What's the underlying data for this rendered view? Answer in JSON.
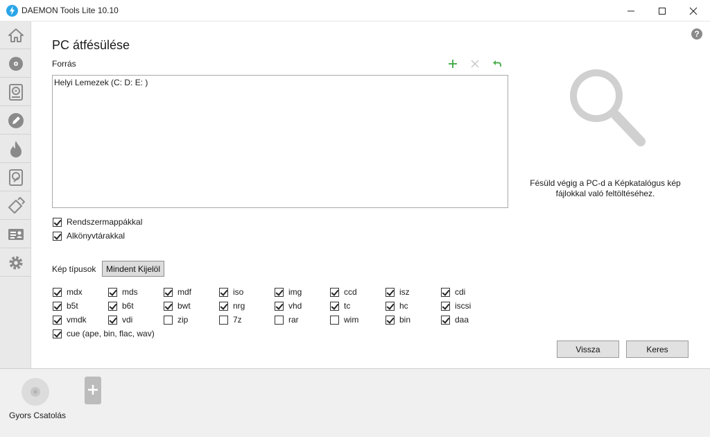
{
  "window": {
    "title": "DAEMON Tools Lite 10.10",
    "controls": [
      "minimize-icon",
      "maximize-icon",
      "close-icon"
    ]
  },
  "sidebar": {
    "items": [
      {
        "icon": "home-icon"
      },
      {
        "icon": "disc-icon"
      },
      {
        "icon": "hard-disk-image-icon"
      },
      {
        "icon": "edit-pencil-icon"
      },
      {
        "icon": "burn-flame-icon"
      },
      {
        "icon": "virtual-hdd-icon"
      },
      {
        "icon": "usb-tag-icon"
      },
      {
        "icon": "id-card-icon"
      },
      {
        "icon": "settings-gear-icon"
      }
    ]
  },
  "help": {
    "label": "?"
  },
  "main": {
    "title": "PC átfésülése",
    "source_label": "Forrás",
    "toolbar": [
      "add-icon",
      "remove-icon",
      "undo-icon"
    ],
    "source_items": [
      "Helyi Lemezek (C: D: E: )"
    ],
    "options": [
      {
        "label": "Rendszermappákkal",
        "checked": true
      },
      {
        "label": "Alkönyvtárakkal",
        "checked": true
      }
    ],
    "image_types_label": "Kép típusok",
    "select_all_label": "Mindent Kijelöl",
    "types": [
      {
        "label": "mdx",
        "checked": true
      },
      {
        "label": "mds",
        "checked": true
      },
      {
        "label": "mdf",
        "checked": true
      },
      {
        "label": "iso",
        "checked": true
      },
      {
        "label": "img",
        "checked": true
      },
      {
        "label": "ccd",
        "checked": true
      },
      {
        "label": "isz",
        "checked": true
      },
      {
        "label": "cdi",
        "checked": true
      },
      {
        "label": "b5t",
        "checked": true
      },
      {
        "label": "b6t",
        "checked": true
      },
      {
        "label": "bwt",
        "checked": true
      },
      {
        "label": "nrg",
        "checked": true
      },
      {
        "label": "vhd",
        "checked": true
      },
      {
        "label": "tc",
        "checked": true
      },
      {
        "label": "hc",
        "checked": true
      },
      {
        "label": "iscsi",
        "checked": true
      },
      {
        "label": "vmdk",
        "checked": true
      },
      {
        "label": "vdi",
        "checked": true
      },
      {
        "label": "zip",
        "checked": false
      },
      {
        "label": "7z",
        "checked": false
      },
      {
        "label": "rar",
        "checked": false
      },
      {
        "label": "wim",
        "checked": false
      },
      {
        "label": "bin",
        "checked": true
      },
      {
        "label": "daa",
        "checked": true
      },
      {
        "label": "cue (ape, bin, flac, wav)",
        "checked": true
      }
    ]
  },
  "right_panel": {
    "icon": "magnifier-icon",
    "text_line1": "Fésüld végig a PC-d a Képkatalógus kép",
    "text_line2": "fájlokkal való feltöltéséhez."
  },
  "buttons": {
    "back_label": "Vissza",
    "search_label": "Keres"
  },
  "bottom": {
    "quick_mount_label": "Gyors Csatolás",
    "add_device_icon": "add-device-icon"
  },
  "colors": {
    "accent_green": "#4caf50",
    "sidebar_bg": "#e9e9e9",
    "icon_gray": "#8a8a8a"
  }
}
